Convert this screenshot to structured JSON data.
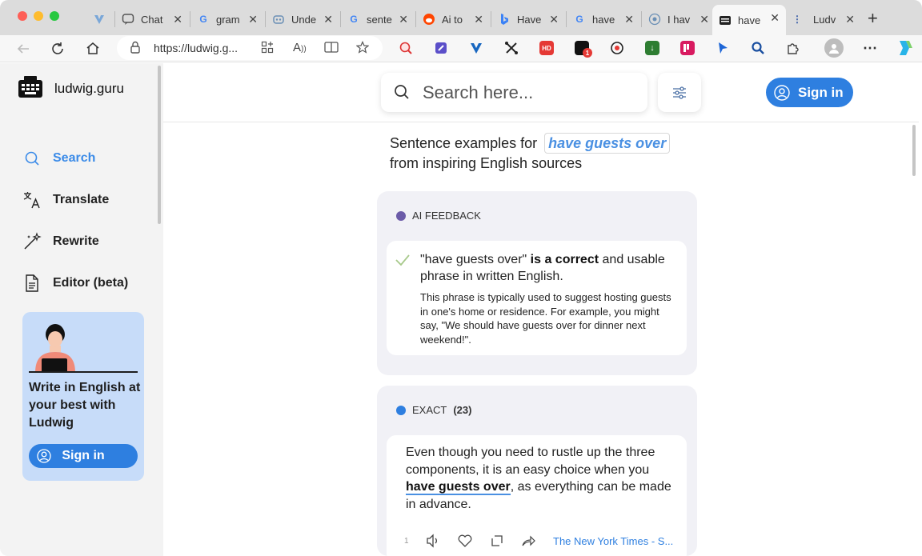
{
  "browser": {
    "tabs": [
      {
        "title": "Chat",
        "icon": "chat-icon"
      },
      {
        "title": "gram",
        "icon": "google-icon"
      },
      {
        "title": "Unde",
        "icon": "robot-icon"
      },
      {
        "title": "sente",
        "icon": "google-icon"
      },
      {
        "title": "Ai to",
        "icon": "reddit-icon"
      },
      {
        "title": "Have",
        "icon": "bing-icon"
      },
      {
        "title": "have",
        "icon": "google-icon"
      },
      {
        "title": "I hav",
        "icon": "globe-icon"
      },
      {
        "title": "have",
        "icon": "ludwig-icon",
        "active": true
      },
      {
        "title": "Ludv",
        "icon": "ludwig-icon"
      }
    ],
    "url_host": "https://ludwig.g...",
    "extension_badge": "1"
  },
  "sidebar": {
    "brand": "ludwig.guru",
    "nav": [
      {
        "label": "Search",
        "icon": "search-icon",
        "active": true
      },
      {
        "label": "Translate",
        "icon": "translate-icon"
      },
      {
        "label": "Rewrite",
        "icon": "magic-wand-icon"
      },
      {
        "label": "Editor (beta)",
        "icon": "document-icon"
      }
    ],
    "promo": {
      "text": "Write in English at your best with Ludwig",
      "button": "Sign in"
    }
  },
  "header": {
    "search_placeholder": "Search here...",
    "signin": "Sign in"
  },
  "results": {
    "headline_prefix": "Sentence examples for",
    "phrase": "have guests over",
    "headline_suffix": "from inspiring English sources",
    "ai_feedback": {
      "label": "AI FEEDBACK",
      "quote": "\"have guests over\"",
      "verdict": "is a correct",
      "rest": "and usable phrase in written English.",
      "explanation": "This phrase is typically used to suggest hosting guests in one's home or residence. For example, you might say, \"We should have guests over for dinner next weekend!\"."
    },
    "exact": {
      "label": "EXACT",
      "count": "(23)",
      "example": {
        "before": "Even though you need to rustle up the three components, it is an easy choice when you ",
        "highlight": "have guests over",
        "after": ", as everything can be made in advance.",
        "index": "1",
        "source": "The New York Times - S..."
      }
    }
  },
  "colors": {
    "accent": "#2e7fe0",
    "ai_dot": "#6b5ba8",
    "exact_dot": "#2e7fe0",
    "check": "#a7c98a"
  }
}
